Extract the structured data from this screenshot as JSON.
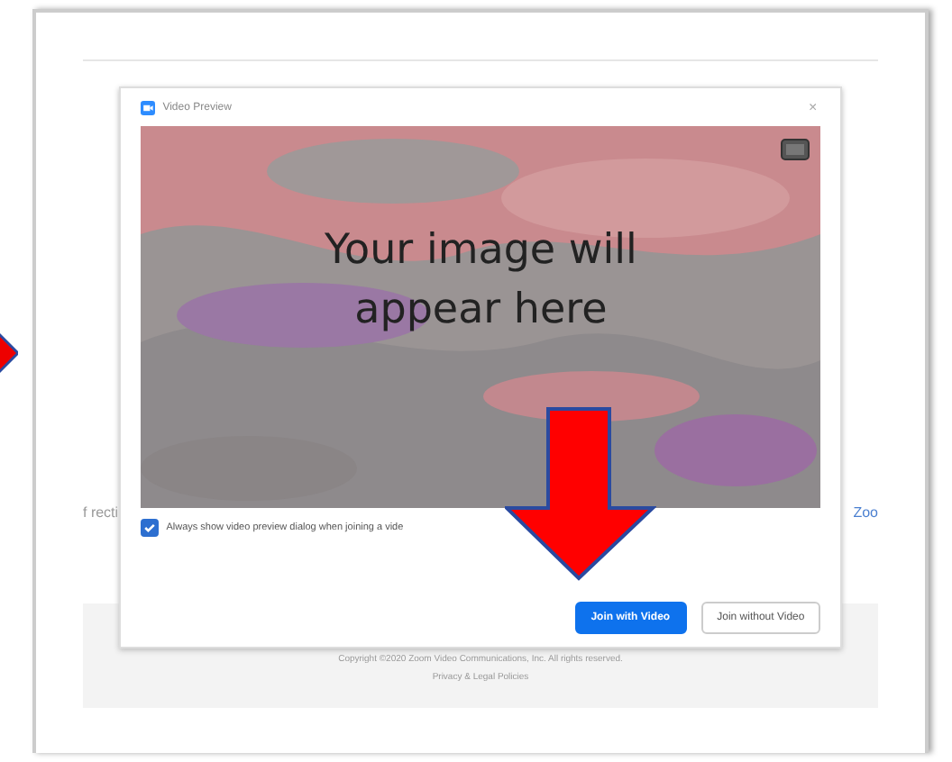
{
  "page": {
    "left_text": "f recti",
    "right_link": "Zoo"
  },
  "dialog": {
    "title": "Video Preview",
    "close": "×",
    "preview_message": "Your image will appear here",
    "checkbox": {
      "label": "Always show video preview dialog when joining a vide",
      "checked": true
    },
    "buttons": [
      {
        "label": "Join with Video",
        "kind": "primary"
      },
      {
        "label": "Join without Video",
        "kind": "secondary"
      }
    ]
  },
  "footer": {
    "copyright": "Copyright ©2020 Zoom Video Communications, Inc. All rights reserved.",
    "links": "Privacy & Legal Policies"
  }
}
